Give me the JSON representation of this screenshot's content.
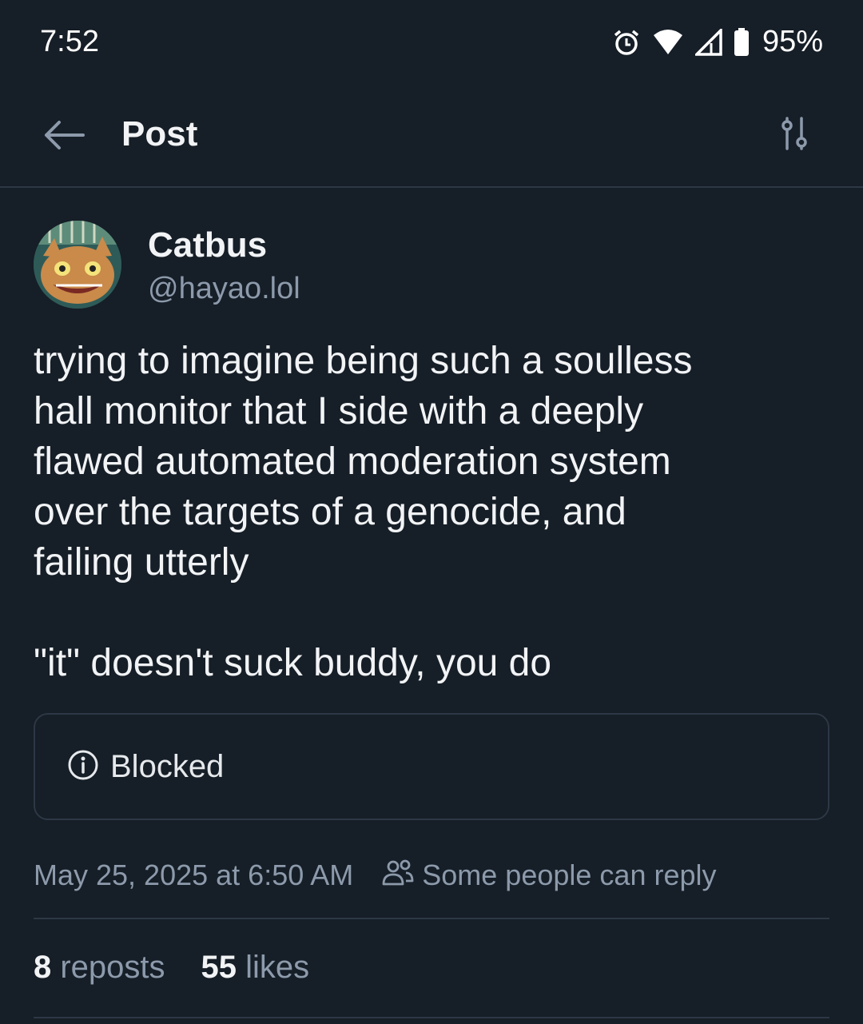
{
  "status_bar": {
    "time": "7:52",
    "battery": "95%",
    "icons": [
      "alarm-icon",
      "wifi-icon",
      "signal-icon",
      "battery-icon"
    ]
  },
  "header": {
    "title": "Post",
    "back_icon": "arrow-left-icon",
    "filter_icon": "sliders-icon"
  },
  "post": {
    "author": {
      "display_name": "Catbus",
      "handle": "@hayao.lol"
    },
    "text_lines": [
      "trying to imagine being such a soulless",
      "hall monitor that I side with a deeply",
      "flawed automated moderation system",
      "over the targets of a genocide, and",
      "failing utterly"
    ],
    "text_line2": "\"it\" doesn't suck buddy, you do",
    "blocked_label": "Blocked",
    "timestamp": "May 25, 2025 at 6:50 AM",
    "reply_setting": "Some people can reply",
    "reposts_count": "8",
    "reposts_label": "reposts",
    "likes_count": "55",
    "likes_label": "likes"
  },
  "colors": {
    "background": "#161e27",
    "text": "#f1f3f5",
    "muted": "#8c9aab",
    "border": "#2c3845"
  }
}
